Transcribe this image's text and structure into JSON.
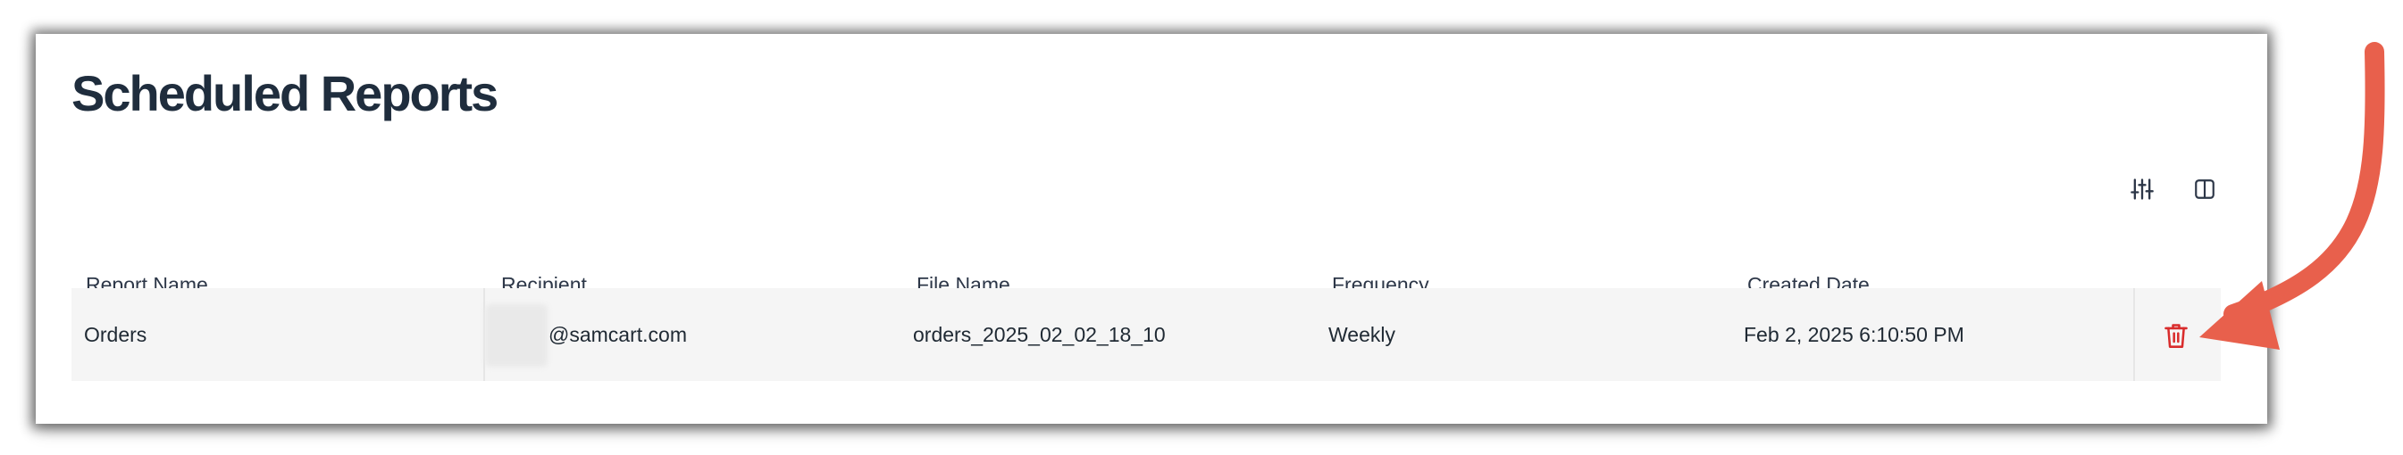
{
  "page": {
    "title": "Scheduled Reports"
  },
  "toolbar": {
    "filter_icon": "sliders-icon",
    "columns_icon": "columns-icon"
  },
  "table": {
    "columns": [
      "Report Name",
      "Recipient",
      "File Name",
      "Frequency",
      "Created Date"
    ],
    "rows": [
      {
        "report_name": "Orders",
        "recipient": "@samcart.com",
        "file_name": "orders_2025_02_02_18_10",
        "frequency": "Weekly",
        "created_date": "Feb 2, 2025 6:10:50 PM",
        "action_icon": "trash-icon"
      }
    ]
  },
  "colors": {
    "title": "#1f2d3d",
    "delete": "#d92c2c",
    "annotation_arrow": "#e8604c",
    "row_background": "#f5f5f5"
  }
}
